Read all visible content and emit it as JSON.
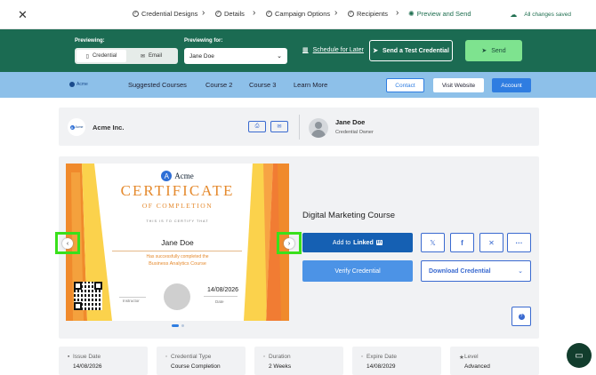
{
  "stepper": {
    "close_icon": "close-icon",
    "steps": [
      {
        "label": "Credential Designs",
        "icon": "check-circle-icon"
      },
      {
        "label": "Details",
        "icon": "check-circle-icon"
      },
      {
        "label": "Campaign Options",
        "icon": "check-circle-icon"
      },
      {
        "label": "Recipients",
        "icon": "check-circle-icon"
      },
      {
        "label": "Preview and Send",
        "icon": "sun-icon"
      }
    ],
    "save_status": "All changes saved",
    "colors": {
      "active": "#1e6e4f"
    }
  },
  "preview_bar": {
    "previewing_label": "Previewing:",
    "toggle": {
      "credential": "Credential",
      "email": "Email",
      "selected": "Credential"
    },
    "previewing_for_label": "Previewing for:",
    "previewing_for_value": "Jane Doe",
    "schedule_label": "Schedule for Later",
    "send_test_label": "Send a Test Credential",
    "send_label": "Send",
    "colors": {
      "bar": "#1b6b52",
      "send": "#7ee38f"
    }
  },
  "nav": {
    "logo_text": "Acme",
    "links": [
      "Suggested Courses",
      "Course 2",
      "Course 3",
      "Learn More"
    ],
    "contact_label": "Contact",
    "visit_label": "Visit Website",
    "account_label": "Account",
    "colors": {
      "bar": "#8dc0e9",
      "account": "#2f7de1"
    }
  },
  "issuer": {
    "org_name": "Acme Inc.",
    "logo_letter": "A",
    "logo_text": "Acme",
    "owner_name": "Jane Doe",
    "owner_role": "Credential Owner"
  },
  "certificate": {
    "logo_letter": "A",
    "logo_text": "Acme",
    "title": "CERTIFICATE",
    "subtitle": "OF COMPLETION",
    "certify_text": "THIS IS TO CERTIFY THAT",
    "recipient": "Jane Doe",
    "completed_text": "Has successfully completed the",
    "course": "Business Analytics Course",
    "instructor_label": "Instructor",
    "date_value": "14/08/2026",
    "date_label": "Date",
    "page_dots": 2,
    "active_dot": 1
  },
  "credential_panel": {
    "course_name": "Digital Marketing Course",
    "add_linkedin_label": "Add to",
    "linkedin_brand": "Linked",
    "linkedin_in": "in",
    "verify_label": "Verify Credential",
    "download_label": "Download Credential",
    "share_icons": [
      "x-logo-icon",
      "facebook-icon",
      "xing-icon",
      "more-icon"
    ]
  },
  "details": [
    {
      "label": "Issue Date",
      "value": "14/08/2026",
      "icon": "calendar-icon"
    },
    {
      "label": "Credential Type",
      "value": "Course Completion",
      "icon": "badge-icon"
    },
    {
      "label": "Duration",
      "value": "2 Weeks",
      "icon": "clock-icon"
    },
    {
      "label": "Expire Date",
      "value": "14/08/2029",
      "icon": "calendar-icon"
    },
    {
      "label": "Level",
      "value": "Advanced",
      "icon": "star-icon"
    }
  ]
}
